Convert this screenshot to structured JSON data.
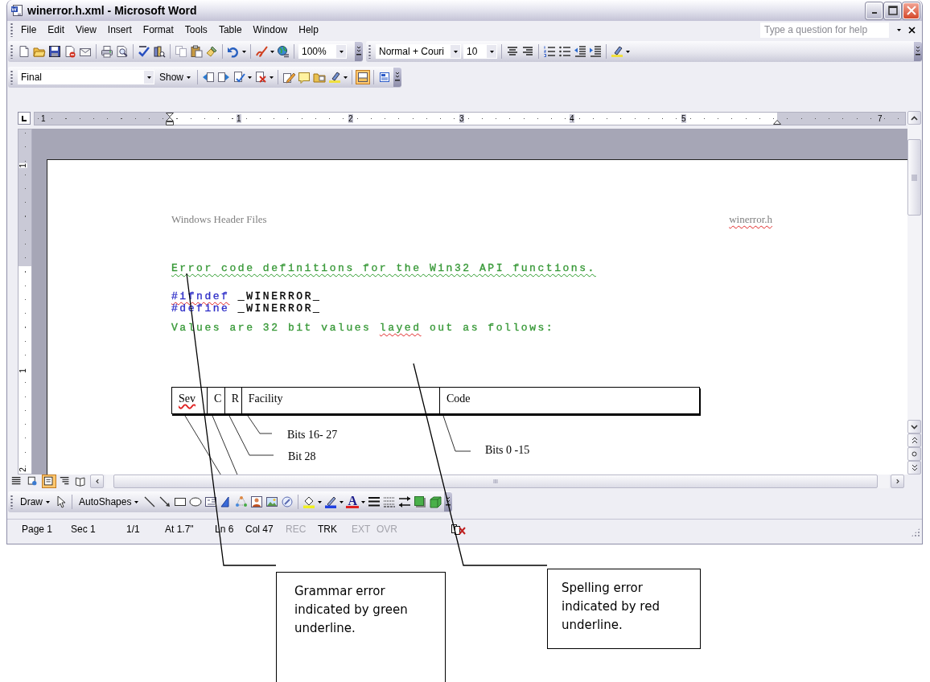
{
  "window": {
    "title": "winerror.h.xml - Microsoft Word"
  },
  "menu": [
    "File",
    "Edit",
    "View",
    "Insert",
    "Format",
    "Tools",
    "Table",
    "Window",
    "Help"
  ],
  "help_box": {
    "placeholder": "Type a question for help"
  },
  "standard_toolbar": {
    "zoom": "100%"
  },
  "formatting_toolbar": {
    "style": "Normal + Couri",
    "font_size": "10"
  },
  "reviewing_toolbar": {
    "display": "Final",
    "show_button": "Show",
    "reviewing_pane_on": true
  },
  "ruler": {
    "labels": [
      "1",
      "1",
      "2",
      "3",
      "4",
      "5",
      "7"
    ]
  },
  "vertical_ruler": {
    "labels": [
      "1",
      "1",
      "2"
    ]
  },
  "document": {
    "header": {
      "left": "Windows Header Files",
      "right": {
        "text": "winerror.h",
        "spelling_error": true
      }
    },
    "lines": [
      {
        "spans": [
          {
            "text": "Error code definitions for the Win32 API functions.",
            "color": "#3a9a3a",
            "spelling_error": false,
            "grammar_error": true
          }
        ]
      },
      {
        "spans": [
          {
            "text": "#ifndef",
            "color": "#3030c8",
            "spelling_error": true,
            "grammar_error": false
          },
          {
            "text": " _WINERROR_",
            "color": "#000000",
            "spelling_error": false,
            "grammar_error": false
          }
        ]
      },
      {
        "spans": [
          {
            "text": "#define",
            "color": "#3030c8",
            "spelling_error": false,
            "grammar_error": false
          },
          {
            "text": " _WINERROR_",
            "color": "#000000",
            "spelling_error": false,
            "grammar_error": false
          }
        ]
      },
      {
        "spans": [
          {
            "text": "Values are 32 bit values ",
            "color": "#3a9a3a",
            "spelling_error": false,
            "grammar_error": false
          },
          {
            "text": "layed",
            "color": "#3a9a3a",
            "spelling_error": true,
            "grammar_error": false
          },
          {
            "text": " out as follows:",
            "color": "#3a9a3a",
            "spelling_error": false,
            "grammar_error": false
          }
        ]
      }
    ],
    "table": {
      "cells": [
        {
          "text": "Sev",
          "spelling_error": true
        },
        {
          "text": "C",
          "spelling_error": false
        },
        {
          "text": "R",
          "spelling_error": false
        },
        {
          "text": "Facility",
          "spelling_error": false
        },
        {
          "text": "Code",
          "spelling_error": false
        }
      ]
    },
    "labels": [
      "Bits 16- 27",
      "Bit 28",
      "Bits 0 -15"
    ]
  },
  "view_buttons": [
    {
      "selected": false
    },
    {
      "selected": false
    },
    {
      "selected": true
    },
    {
      "selected": false
    },
    {
      "selected": false
    }
  ],
  "drawing_toolbar": {
    "draw_button": "Draw",
    "autoshapes_button": "AutoShapes",
    "font_color_glyph": "A"
  },
  "status_bar": [
    {
      "text": "Page 1"
    },
    {
      "text": "Sec 1"
    },
    {
      "text": "1/1"
    },
    {
      "text": "At 1.7\""
    },
    {
      "text": "Ln 6"
    },
    {
      "text": "Col 47"
    },
    {
      "text": "REC",
      "active": false
    },
    {
      "text": "TRK",
      "active": true
    },
    {
      "text": "EXT",
      "active": false
    },
    {
      "text": "OVR",
      "active": false
    }
  ],
  "callouts": [
    {
      "text": "Grammar error indicated by green underline."
    },
    {
      "text": "Spelling error indicated by red underline."
    }
  ]
}
